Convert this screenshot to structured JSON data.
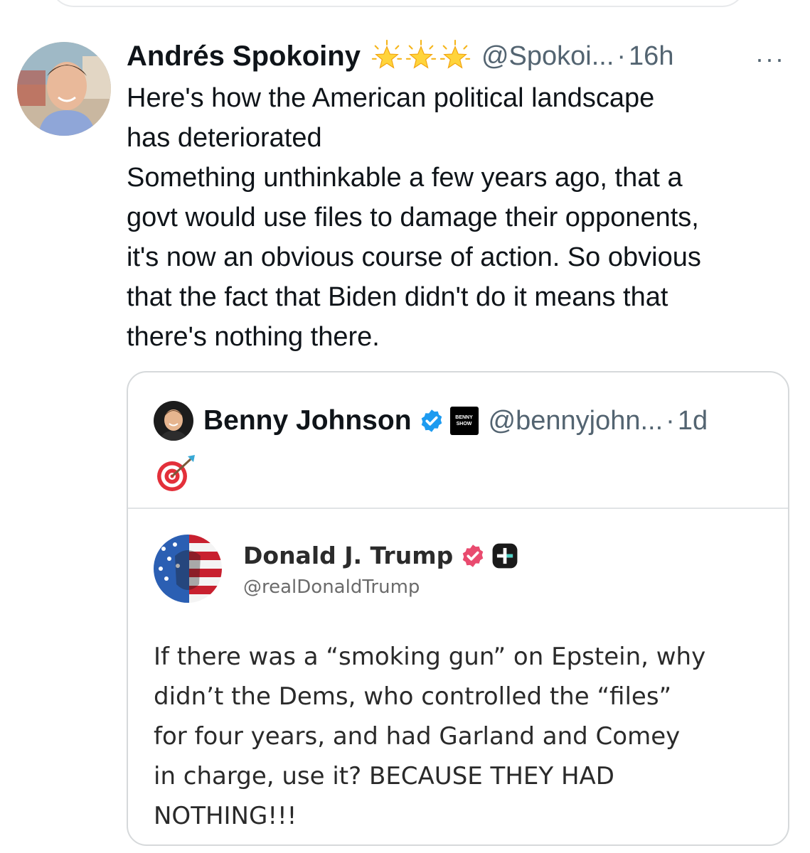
{
  "tweet": {
    "author": {
      "display_name": "Andrés Spokoiny",
      "handle": "@Spokoi...",
      "badges": [
        "glowing-star-icon",
        "glowing-star-icon",
        "glowing-star-icon"
      ]
    },
    "separator": "·",
    "time": "16h",
    "more_label": "···",
    "text_lines": [
      "Here's how the American political landscape",
      "has deteriorated",
      "Something unthinkable a few years ago, that a",
      "govt would use files to damage their opponents,",
      "it's now an obvious course of action. So obvious",
      "that the fact that Biden didn't do it means that",
      "there's nothing there."
    ]
  },
  "quoted_tweet": {
    "author": {
      "display_name": "Benny Johnson",
      "handle": "@bennyjohn...",
      "verified": true,
      "badge_text": [
        "BENNY",
        "SHOW"
      ]
    },
    "separator": "·",
    "time": "1d",
    "emoji": "direct-hit-target-icon",
    "embedded_post": {
      "display_name": "Donald J. Trump",
      "handle": "@realDonaldTrump",
      "text_lines": [
        "If there was a “smoking gun” on Epstein, why",
        "didn’t the Dems, who controlled the “files”",
        "for four years, and had Garland and Comey",
        "in charge, use it? BECAUSE THEY HAD",
        "NOTHING!!!"
      ]
    }
  },
  "colors": {
    "text_primary": "#0f1419",
    "text_secondary": "#536471",
    "verified_blue": "#1d9bf0",
    "truth_verified_pink": "#e94b6f",
    "border": "#d6d9db"
  }
}
